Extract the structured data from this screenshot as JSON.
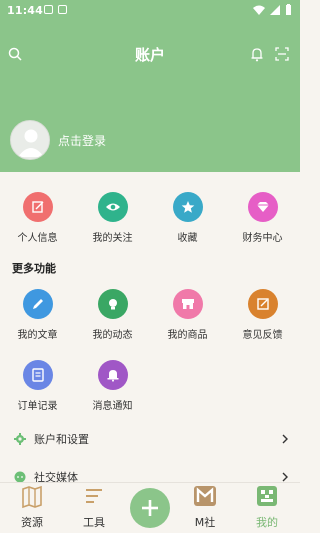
{
  "status_bar": {
    "time": "11:44"
  },
  "header": {
    "title": "账户"
  },
  "profile": {
    "login_label": "点击登录"
  },
  "quick_actions": [
    {
      "label": "个人信息",
      "icon": "edit-icon",
      "color": "#f06f6f"
    },
    {
      "label": "我的关注",
      "icon": "eye-icon",
      "color": "#2fb38c"
    },
    {
      "label": "收藏",
      "icon": "star-icon",
      "color": "#39a9c8"
    },
    {
      "label": "财务中心",
      "icon": "diamond-icon",
      "color": "#e65ec6"
    }
  ],
  "more": {
    "title": "更多功能",
    "row1": [
      {
        "label": "我的文章",
        "icon": "pencil-icon",
        "color": "#3f98e0"
      },
      {
        "label": "我的动态",
        "icon": "bulb-icon",
        "color": "#3aa764"
      },
      {
        "label": "我的商品",
        "icon": "shop-icon",
        "color": "#f079a9"
      },
      {
        "label": "意见反馈",
        "icon": "feedback-icon",
        "color": "#d9822e"
      }
    ],
    "row2": [
      {
        "label": "订单记录",
        "icon": "order-icon",
        "color": "#6a86e5"
      },
      {
        "label": "消息通知",
        "icon": "bell-icon",
        "color": "#a057c6"
      }
    ]
  },
  "menu": [
    {
      "label": "账户和设置",
      "icon": "gear-icon"
    },
    {
      "label": "社交媒体",
      "icon": "chat-icon"
    }
  ],
  "tabs": [
    {
      "label": "资源",
      "icon": "map-icon"
    },
    {
      "label": "工具",
      "icon": "tools-icon"
    },
    {
      "label": "M社",
      "icon": "m-icon"
    },
    {
      "label": "我的",
      "icon": "me-icon"
    }
  ],
  "colors": {
    "primary": "#8bc58a",
    "active_tab": "#7ab874"
  }
}
